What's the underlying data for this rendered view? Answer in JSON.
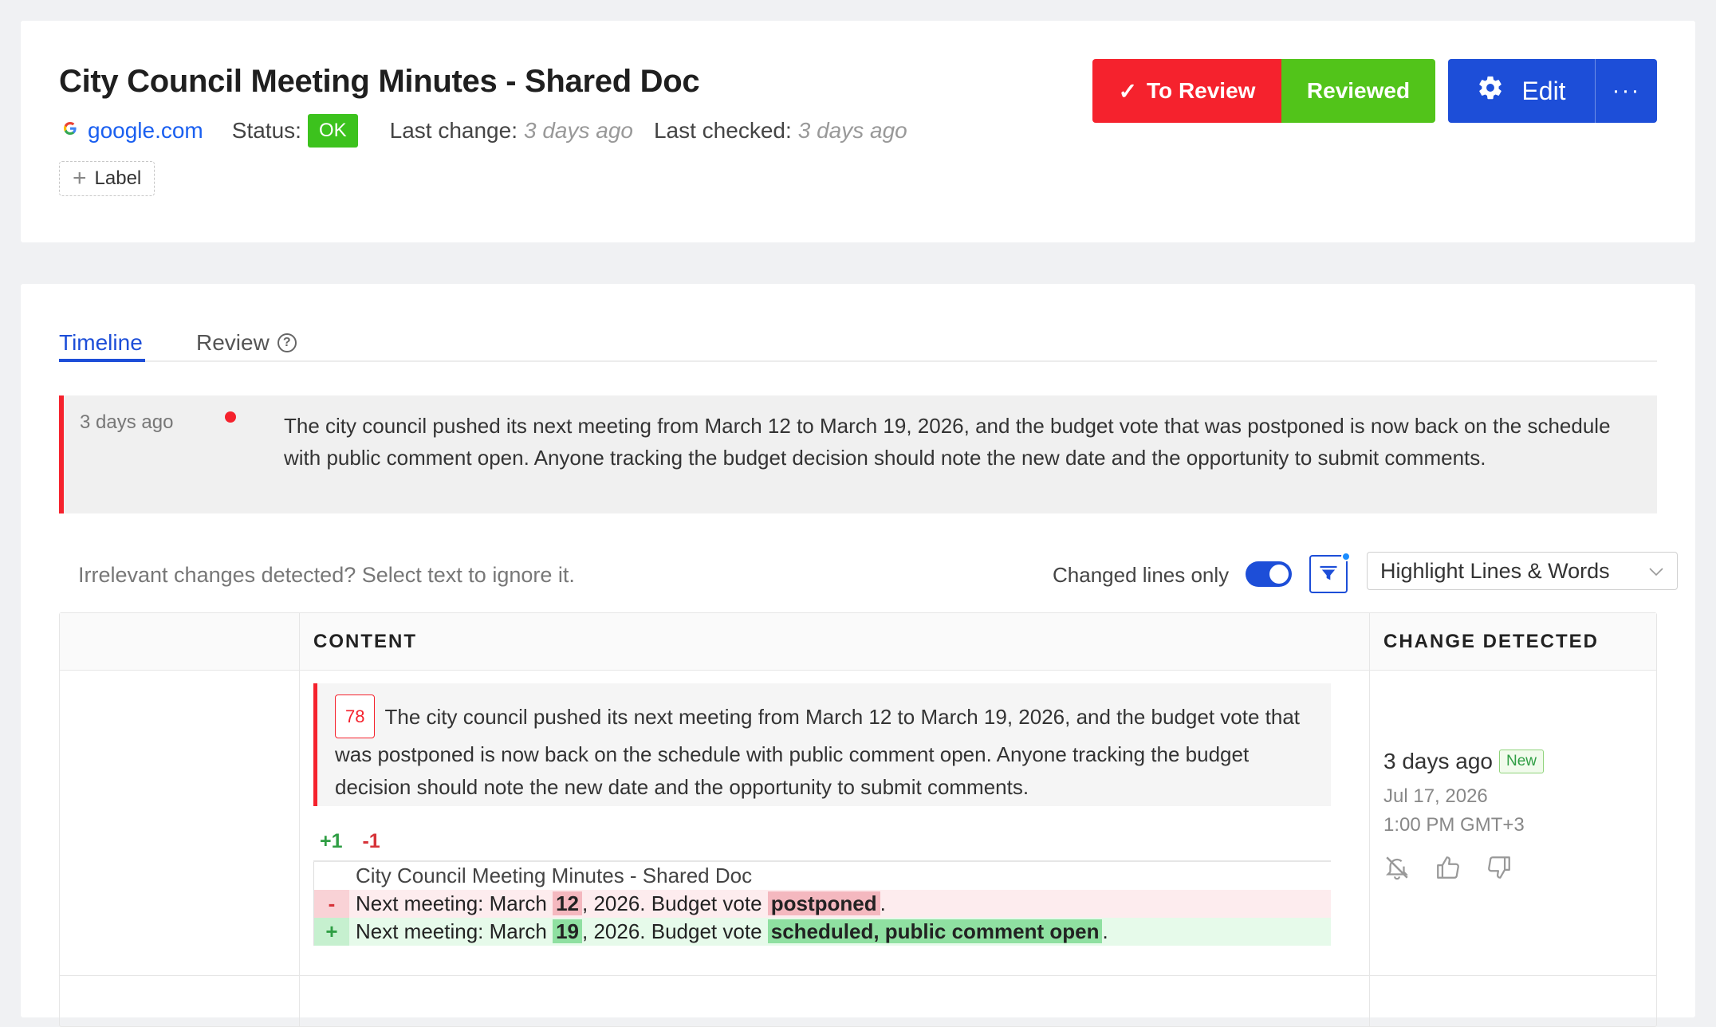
{
  "header": {
    "title": "City Council Meeting Minutes - Shared Doc",
    "domain": "google.com",
    "status_label": "Status:",
    "status_value": "OK",
    "last_change_label": "Last change:",
    "last_change_value": "3 days ago",
    "last_checked_label": "Last checked:",
    "last_checked_value": "3 days ago",
    "label_button": "Label",
    "to_review_button": "To Review",
    "reviewed_button": "Reviewed",
    "edit_button": "Edit",
    "more_button": "···"
  },
  "tabs": [
    {
      "label": "Timeline",
      "active": true
    },
    {
      "label": "Review",
      "active": false
    }
  ],
  "summary": {
    "time": "3 days ago",
    "text": "The city council pushed its next meeting from March 12 to March 19, 2026, and the budget vote that was postponed is now back on the schedule with public comment open. Anyone tracking the budget decision should note the new date and the opportunity to submit comments."
  },
  "toolbar": {
    "ignore_hint": "Irrelevant changes detected? Select text to ignore it.",
    "changed_lines_label": "Changed lines only",
    "changed_lines_on": true,
    "highlight_mode": "Highlight Lines & Words"
  },
  "table": {
    "col_content": "CONTENT",
    "col_change": "CHANGE DETECTED",
    "row": {
      "line_number": "78",
      "content_text": "The city council pushed its next meeting from March 12 to March 19, 2026, and the budget vote that was postponed is now back on the schedule with public comment open. Anyone tracking the budget decision should note the new date and the opportunity to submit comments.",
      "added_count": "+1",
      "removed_count": "-1",
      "context_line": "City Council Meeting Minutes - Shared Doc",
      "del_marker": "-",
      "add_marker": "+",
      "del_prefix": "Next meeting: March ",
      "del_word1": "12",
      "del_mid": ", 2026. Budget vote ",
      "del_word2": "postponed",
      "del_suffix": ".",
      "add_prefix": "Next meeting: March ",
      "add_word1": "19",
      "add_mid": ", 2026. Budget vote ",
      "add_word2": "scheduled, public comment open",
      "add_suffix": ".",
      "detected_rel": "3 days ago",
      "new_badge": "New",
      "detected_date": "Jul 17, 2026",
      "detected_time": "1:00 PM GMT+3"
    }
  },
  "colors": {
    "primary": "#1d4ed8",
    "danger": "#f5222d",
    "success": "#52c41a"
  }
}
